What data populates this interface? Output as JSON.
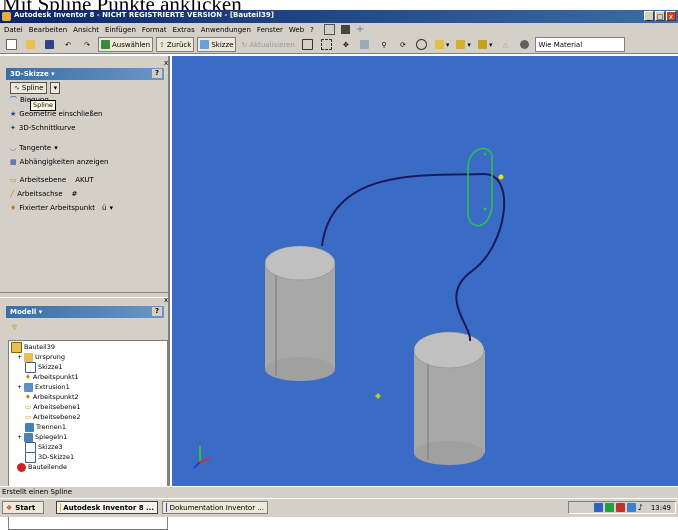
{
  "heading": "Mit Spline Punkte anklicken",
  "window": {
    "title": "Autodesk Inventor 8 - NICHT REGISTRIERTE VERSION - [Bauteil39]",
    "buttons": [
      "_",
      "□",
      "x"
    ]
  },
  "menu": [
    "Datei",
    "Bearbeiten",
    "Ansicht",
    "Einfügen",
    "Format",
    "Extras",
    "Anwendungen",
    "Fenster",
    "Web",
    "?"
  ],
  "toolbar": {
    "auswaehlen": "Auswählen",
    "zurueck": "Zurück",
    "skizze": "Skizze",
    "aktualisieren": "Aktualisieren",
    "material": "Wie Material"
  },
  "sketch_panel": {
    "title": "3D-Skizze",
    "tools": [
      {
        "label": "Spline",
        "tooltip": "Spline"
      },
      {
        "label": "Biegung"
      },
      {
        "label": "Geometrie einschließen"
      },
      {
        "label": "3D-Schnittkurve"
      },
      {
        "label": "Tangente"
      },
      {
        "label": "Abhängigkeiten anzeigen"
      },
      {
        "label": "Arbeitsebene",
        "shortcut": "AKUT"
      },
      {
        "label": "Arbeitsachse",
        "shortcut": "#"
      },
      {
        "label": "Fixierter Arbeitspunkt",
        "shortcut": "ü"
      }
    ]
  },
  "model_panel": {
    "title": "Modell",
    "tree": [
      "Bauteil39",
      "Ursprung",
      "Skizze1",
      "Arbeitspunkt1",
      "Extrusion1",
      "Arbeitspunkt2",
      "Arbeitsebene1",
      "Arbeitsebene2",
      "Trennen1",
      "Spiegeln1",
      "Skizze3",
      "3D-Skizze1",
      "Bauteilende"
    ]
  },
  "status": "Erstellt einen Spline",
  "taskbar": {
    "start": "Start",
    "tasks": [
      "Autodesk Inventor 8 ...",
      "Dokumentation Inventor ..."
    ],
    "clock": "13:49"
  },
  "colors": {
    "viewport_bg": "#3b6cc5",
    "spline": "#1a1a5a",
    "workplane": "#2fc04a"
  }
}
